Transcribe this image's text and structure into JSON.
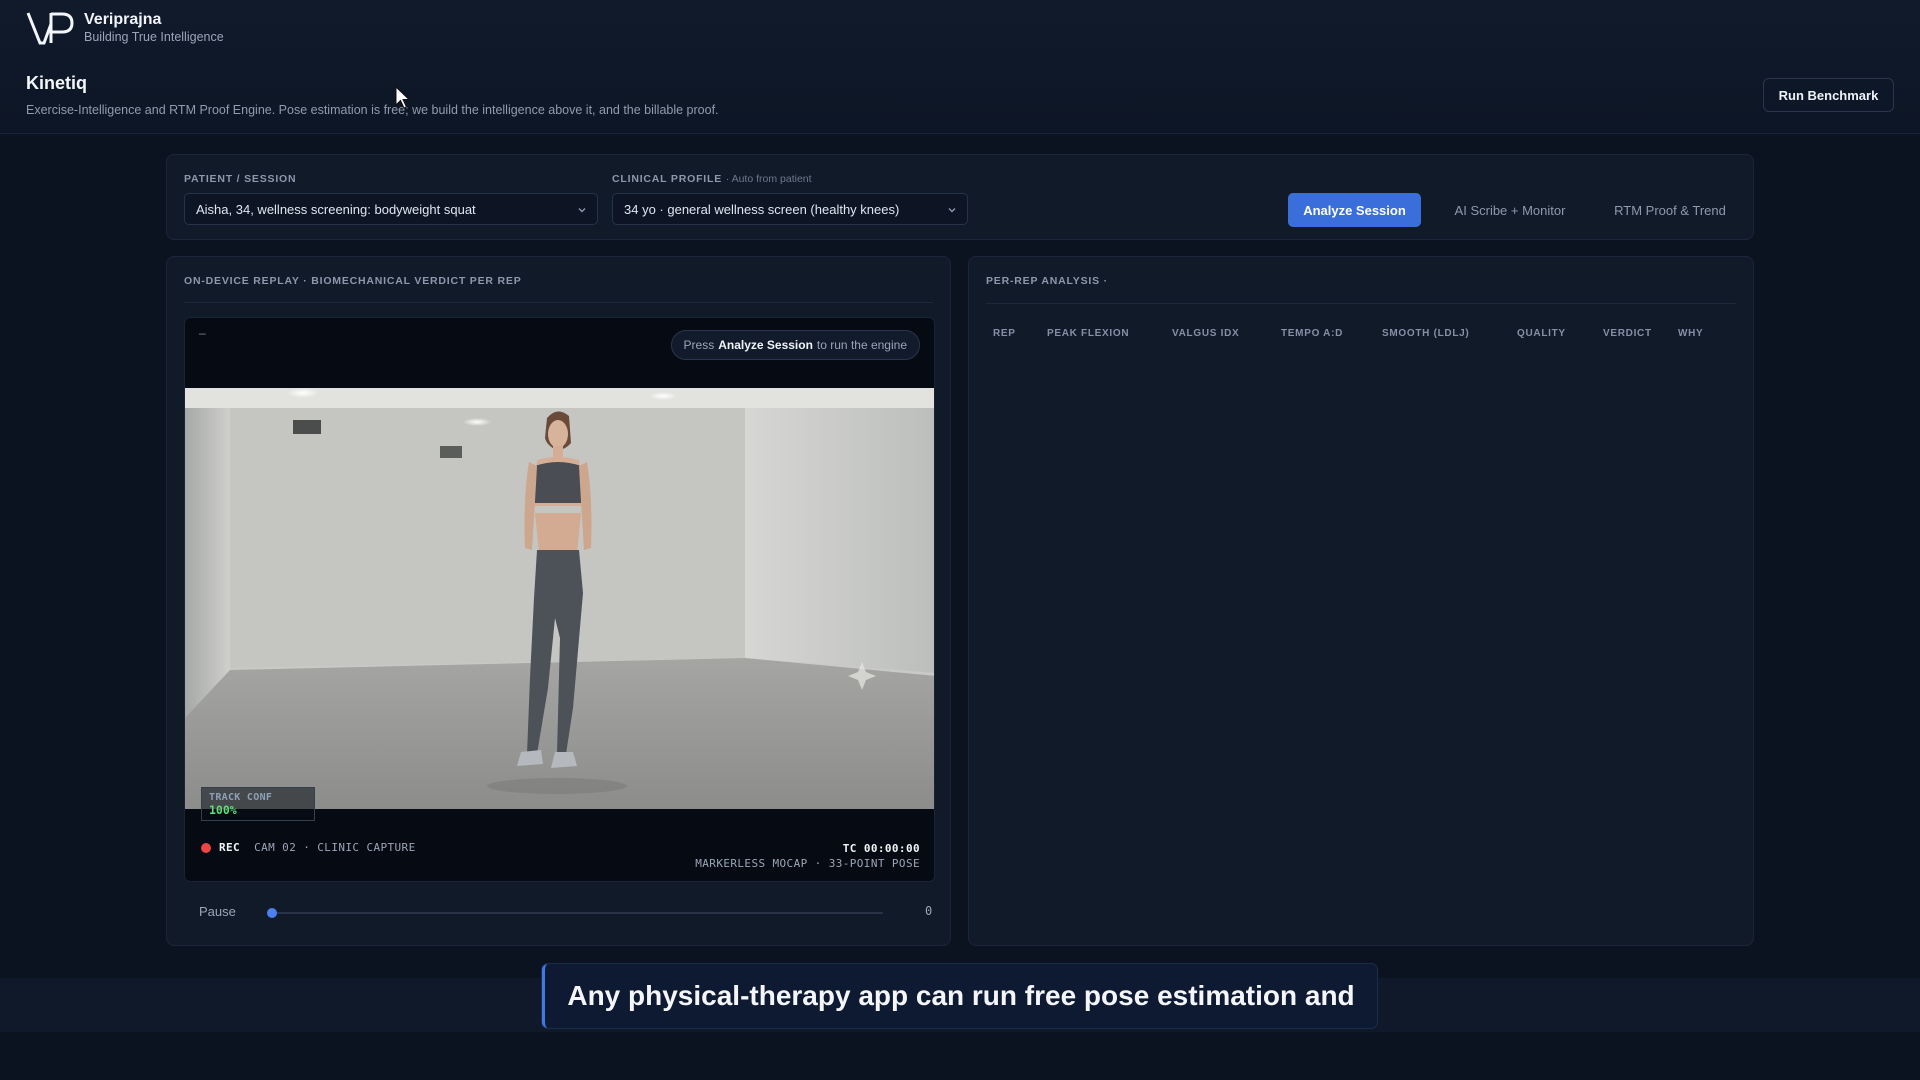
{
  "brand": {
    "name": "Veriprajna",
    "tagline": "Building True Intelligence",
    "logo_text": "VP"
  },
  "app": {
    "title": "Kinetiq",
    "description": "Exercise-Intelligence and RTM Proof Engine. Pose estimation is free; we build the intelligence above it, and the billable proof.",
    "run_benchmark_label": "Run Benchmark"
  },
  "controls": {
    "patient_label": "PATIENT / SESSION",
    "patient_value": "Aisha, 34, wellness screening: bodyweight squat",
    "profile_label": "CLINICAL PROFILE",
    "profile_sub": "· Auto from patient",
    "profile_value": "34 yo · general wellness screen (healthy knees)",
    "tabs": [
      {
        "label": "Analyze Session",
        "active": true
      },
      {
        "label": "AI Scribe + Monitor",
        "active": false
      },
      {
        "label": "RTM Proof & Trend",
        "active": false
      }
    ]
  },
  "replay": {
    "title": "ON-DEVICE REPLAY · BIOMECHANICAL VERDICT PER REP",
    "status_dash": "–",
    "hint_prefix": "Press",
    "hint_bold": "Analyze Session",
    "hint_suffix": "to run the engine",
    "track_conf_label": "TRACK CONF",
    "track_conf_value": "100%",
    "rec_label": "REC",
    "camera_label": "CAM 02 · CLINIC CAPTURE",
    "timecode": "TC 00:00:00",
    "mocap_label": "MARKERLESS MOCAP · 33-POINT POSE",
    "pause_label": "Pause",
    "slider_value": "0",
    "slider_fraction": 0
  },
  "analysis": {
    "title": "PER-REP ANALYSIS ·",
    "columns": [
      "REP",
      "PEAK FLEXION",
      "VALGUS IDX",
      "TEMPO A:D",
      "SMOOTH (LDLJ)",
      "QUALITY",
      "VERDICT",
      "WHY"
    ],
    "rows": []
  },
  "caption": {
    "text": "Any physical-therapy app can run free pose estimation and"
  },
  "colors": {
    "accent": "#3a6fdb",
    "rec": "#ef4444",
    "track_conf": "#5ee07a",
    "background": "#0c1320"
  }
}
